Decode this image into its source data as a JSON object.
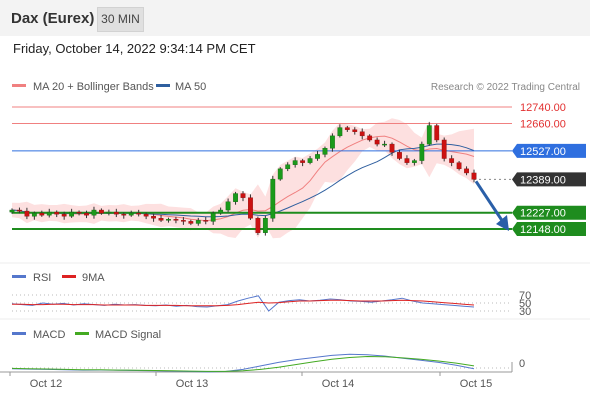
{
  "header": {
    "title": "Dax (Eurex)",
    "timeframe": "30 MIN",
    "datetime": "Friday, October 14, 2022 9:34:14 PM CET"
  },
  "legend": {
    "ma20_label": "MA 20 + Bollinger Bands",
    "ma50_label": "MA 50",
    "credit": "Research © 2022 Trading Central",
    "rsi_label": "RSI",
    "rsi_ma_label": "9MA",
    "macd_label": "MACD",
    "macd_signal_label": "MACD Signal"
  },
  "colors": {
    "resistance": "#f08080",
    "ma50": "#2f5f9f",
    "pivot": "#2f6fdf",
    "support": "#1e8c1e",
    "last": "#333333",
    "bollinger_fill": "#fde0e0",
    "candle_up": "#1a9a1a",
    "candle_down": "#cc1111",
    "rsi": "#5577cc",
    "rsi_ma": "#dd2222",
    "macd": "#5577cc",
    "macd_signal": "#44aa22",
    "arrow": "#2a5fa8"
  },
  "chart_data": [
    {
      "type": "candlestick",
      "title": "Dax (Eurex)",
      "x_ticks": [
        "Oct 12",
        "Oct 13",
        "Oct 14",
        "Oct 15"
      ],
      "y_range": [
        12090,
        12810
      ],
      "levels": [
        {
          "label": "12740.00",
          "value": 12740,
          "kind": "resistance"
        },
        {
          "label": "12660.00",
          "value": 12660,
          "kind": "resistance"
        },
        {
          "label": "12527.00",
          "value": 12527,
          "kind": "pivot"
        },
        {
          "label": "12389.00",
          "value": 12389,
          "kind": "last"
        },
        {
          "label": "12227.00",
          "value": 12227,
          "kind": "support"
        },
        {
          "label": "12148.00",
          "value": 12148,
          "kind": "support"
        }
      ],
      "close_path": [
        12240,
        12235,
        12210,
        12225,
        12215,
        12230,
        12220,
        12210,
        12230,
        12225,
        12215,
        12240,
        12225,
        12230,
        12220,
        12215,
        12225,
        12220,
        12210,
        12200,
        12190,
        12195,
        12190,
        12185,
        12175,
        12190,
        12185,
        12225,
        12240,
        12280,
        12320,
        12300,
        12200,
        12130,
        12200,
        12390,
        12440,
        12460,
        12480,
        12470,
        12490,
        12510,
        12540,
        12600,
        12640,
        12630,
        12620,
        12600,
        12580,
        12560,
        12560,
        12520,
        12490,
        12470,
        12480,
        12560,
        12650,
        12580,
        12490,
        12470,
        12440,
        12420,
        12389
      ],
      "forecast_arrow": {
        "from": 12389,
        "to": 12148
      }
    },
    {
      "type": "line",
      "title": "RSI",
      "y_ticks": [
        "70",
        "50",
        "30"
      ],
      "series": [
        {
          "name": "RSI",
          "values": [
            48,
            46,
            44,
            50,
            47,
            49,
            45,
            48,
            46,
            44,
            47,
            45,
            46,
            44,
            43,
            45,
            42,
            44,
            41,
            40,
            43,
            46,
            55,
            62,
            68,
            30,
            52,
            56,
            58,
            55,
            57,
            60,
            58,
            55,
            54,
            52,
            55,
            58,
            62,
            55,
            50,
            48,
            46,
            44,
            42,
            40
          ]
        },
        {
          "name": "9MA",
          "values": [
            47,
            47,
            46,
            46,
            47,
            47,
            46,
            46,
            46,
            45,
            45,
            45,
            45,
            44,
            44,
            44,
            44,
            43,
            43,
            43,
            43,
            44,
            46,
            49,
            52,
            50,
            51,
            53,
            55,
            55,
            56,
            57,
            57,
            56,
            55,
            55,
            55,
            56,
            57,
            56,
            55,
            53,
            51,
            49,
            47,
            45
          ]
        }
      ]
    },
    {
      "type": "line",
      "title": "MACD",
      "y_ticks": [
        "0"
      ],
      "series": [
        {
          "name": "MACD",
          "values": [
            -5,
            -8,
            -10,
            -12,
            -15,
            -14,
            -16,
            -18,
            -20,
            -22,
            -25,
            -28,
            -25,
            -10,
            15,
            40,
            60,
            75,
            90,
            98,
            95,
            85,
            70,
            55,
            40,
            20,
            -5
          ]
        },
        {
          "name": "MACD Signal",
          "values": [
            -3,
            -5,
            -7,
            -10,
            -12,
            -13,
            -15,
            -16,
            -18,
            -20,
            -22,
            -24,
            -24,
            -20,
            -10,
            5,
            25,
            45,
            62,
            75,
            82,
            80,
            72,
            62,
            50,
            35,
            15
          ]
        }
      ]
    }
  ]
}
